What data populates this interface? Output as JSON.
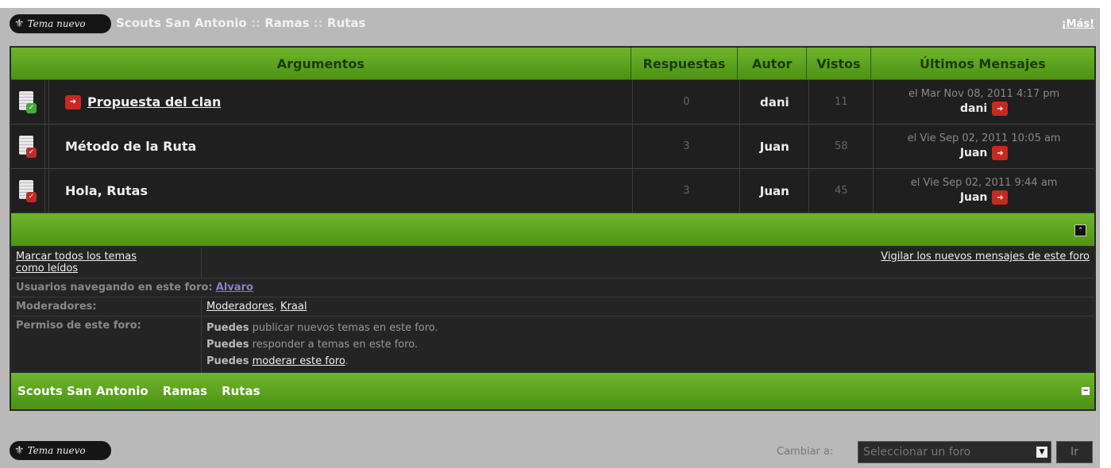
{
  "toolbar": {
    "new_topic_label": "Tema nuevo",
    "breadcrumb": [
      "Scouts San Antonio",
      "Ramas",
      "Rutas"
    ],
    "breadcrumb_sep": "::",
    "more_label": "¡Más!"
  },
  "table": {
    "columns": [
      "Argumentos",
      "Respuestas",
      "Autor",
      "Vistos",
      "Últimos Mensajes"
    ],
    "rows": [
      {
        "title": "Propuesta del clan",
        "replies": "0",
        "author": "dani",
        "views": "11",
        "last_date": "el Mar Nov 08, 2011 4:17 pm",
        "last_user": "dani"
      },
      {
        "title": "Método de la Ruta",
        "replies": "3",
        "author": "Juan",
        "views": "58",
        "last_date": "el Vie Sep 02, 2011 10:05 am",
        "last_user": "Juan"
      },
      {
        "title": "Hola, Rutas",
        "replies": "3",
        "author": "Juan",
        "views": "45",
        "last_date": "el Vie Sep 02, 2011 9:44 am",
        "last_user": "Juan"
      }
    ]
  },
  "info": {
    "mark_read": "Marcar todos los temas",
    "mark_read_2": "como leídos",
    "watch": "Vigilar los nuevos mensajes de este foro",
    "browsing_label": "Usuarios navegando en este foro:",
    "browsing_user": "Alvaro",
    "moderators_label": "Moderadores:",
    "moderators": [
      "Moderadores",
      "Kraal"
    ],
    "permissions_label": "Permiso de este foro:",
    "perm_prefix": "Puedes",
    "perm_1": "publicar nuevos temas en este foro.",
    "perm_2": "responder a temas en este foro.",
    "perm_3_link": "moderar este foro"
  },
  "footer_crumbs": [
    "Scouts San Antonio",
    "Ramas",
    "Rutas"
  ],
  "bottom": {
    "change_label": "Cambiar a:",
    "select_value": "Seleccionar un foro",
    "go_label": "Ir"
  },
  "colors": {
    "accent": "#5ea320",
    "panel": "#222222",
    "frame": "#b9b9b9"
  }
}
